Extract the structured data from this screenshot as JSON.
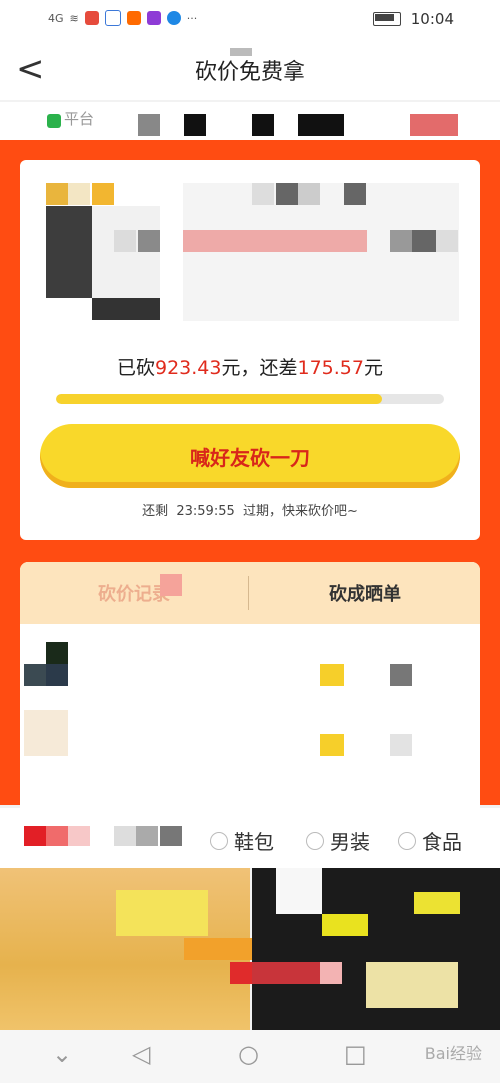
{
  "status_bar": {
    "signal_text": "4G",
    "time": "10:04"
  },
  "nav": {
    "back_glyph": "<",
    "title": "砍价免费拿"
  },
  "strip": {
    "text": "平台"
  },
  "bargain": {
    "cut_prefix": "已砍",
    "cut_amount": "923.43",
    "cut_unit": "元，还差",
    "remain_amount": "175.57",
    "remain_unit": "元",
    "progress": 0.84,
    "cta_label": "喊好友砍一刀",
    "remain_label": "还剩",
    "countdown": "23:59:55",
    "remain_suffix": "过期，快来砍价吧~"
  },
  "tabs": [
    {
      "label": "砍价记录"
    },
    {
      "label": "砍成晒单"
    }
  ],
  "categories": [
    {
      "label": "鞋包"
    },
    {
      "label": "男装"
    },
    {
      "label": "食品"
    }
  ],
  "watermark": "Bai经验",
  "colors": {
    "orange": "#ff4c12",
    "yellow": "#f9d82a",
    "red_text": "#e02b1d",
    "tab_bg": "#fde4bd"
  }
}
